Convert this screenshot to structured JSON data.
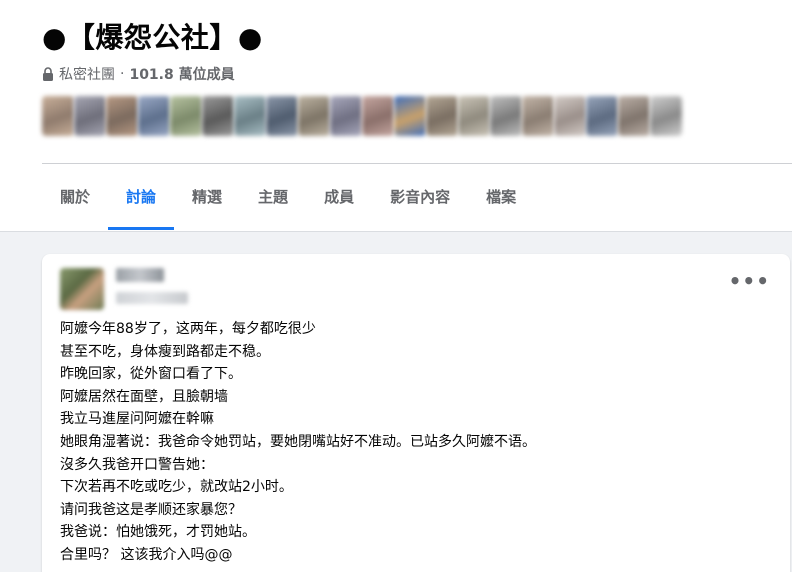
{
  "group": {
    "title": "●【爆怨公社】●",
    "privacy_label": "私密社團",
    "separator": "·",
    "member_count": "101.8 萬位成員",
    "lock_icon": "lock-icon"
  },
  "member_avatars_count": 20,
  "tabs": [
    {
      "label": "關於",
      "active": false
    },
    {
      "label": "討論",
      "active": true
    },
    {
      "label": "精選",
      "active": false
    },
    {
      "label": "主題",
      "active": false
    },
    {
      "label": "成員",
      "active": false
    },
    {
      "label": "影音內容",
      "active": false
    },
    {
      "label": "檔案",
      "active": false
    }
  ],
  "post": {
    "more_label": "•••",
    "lines": [
      "阿嬤今年88岁了，这两年，每夕都吃很少",
      "甚至不吃，身体瘦到路都走不稳。",
      "昨晚回家，從外窗口看了下。",
      "阿嬤居然在面壁，且臉朝墙",
      "我立马進屋问阿嬤在幹嘛",
      "她眼角湿著说：我爸命令她罚站，要她閉嘴站好不准动。已站多久阿嬤不语。",
      "沒多久我爸开口警告她：",
      "下次若再不吃或吃少，就改站2小时。",
      "请问我爸这是孝顺还家暴您？",
      "我爸说：怕她饿死，才罚她站。",
      "合里吗？ 这该我介入吗@@"
    ]
  },
  "colors": {
    "accent": "#1877f2",
    "muted_text": "#65676b",
    "page_bg": "#f0f2f5"
  }
}
